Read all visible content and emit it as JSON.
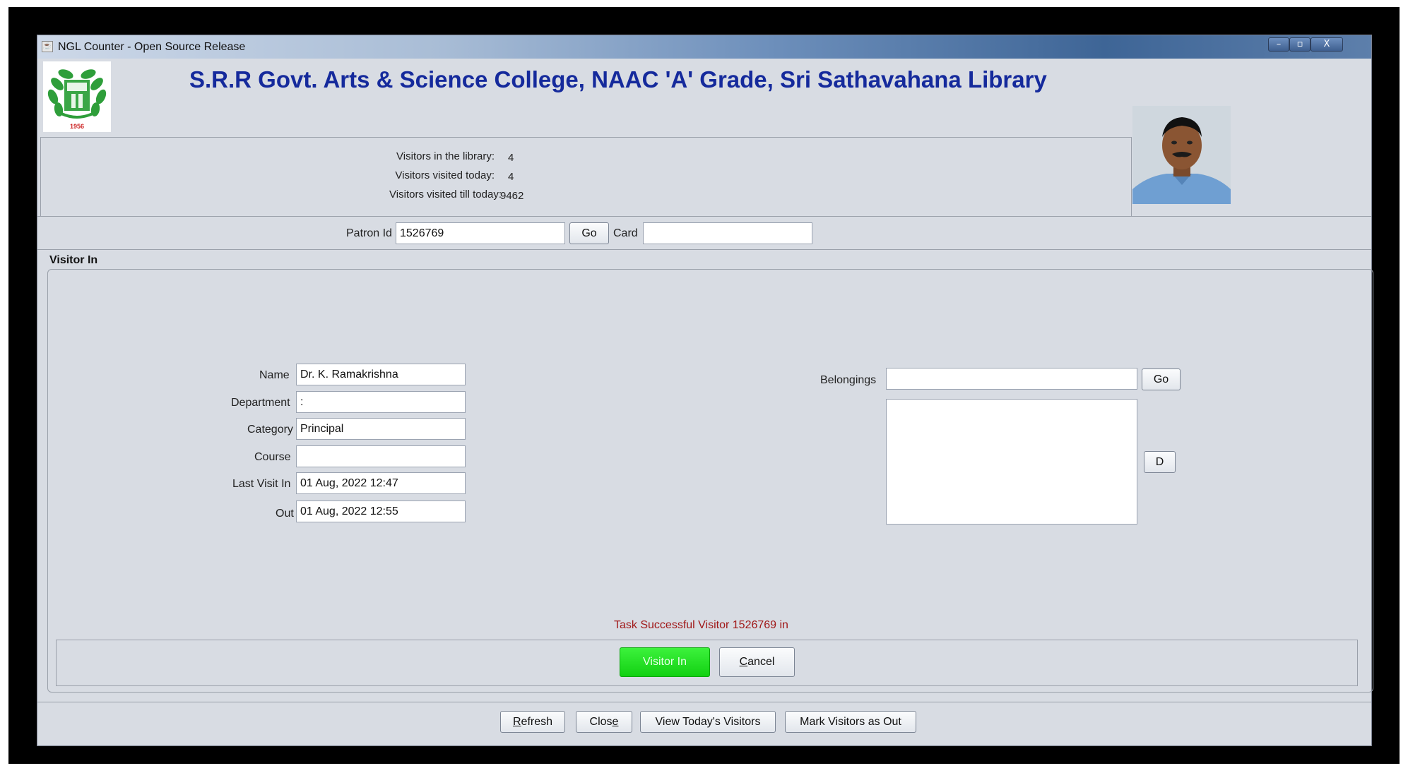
{
  "window": {
    "title": "NGL Counter - Open Source Release",
    "controls": {
      "minimize": "–",
      "maximize": "▫",
      "close": "X"
    }
  },
  "header": {
    "institution": "S.R.R Govt. Arts & Science College, NAAC 'A' Grade, Sri Sathavahana Library",
    "logo_year": "1956"
  },
  "stats": {
    "in_library_label": "Visitors in the library:",
    "in_library_value": "4",
    "today_label": "Visitors visited today:",
    "today_value": "4",
    "till_today_label": "Visitors visited till today:",
    "till_today_value": "9462"
  },
  "patron": {
    "id_label": "Patron Id",
    "id_value": "1526769",
    "go_label": "Go",
    "card_label": "Card",
    "card_value": ""
  },
  "visitor_in": {
    "section_title": "Visitor In",
    "name_label": "Name",
    "name_value": "Dr. K. Ramakrishna",
    "department_label": "Department",
    "department_value": ":",
    "category_label": "Category",
    "category_value": "Principal",
    "course_label": "Course",
    "course_value": "",
    "last_visit_in_label": "Last Visit In",
    "last_visit_in_value": "01 Aug, 2022 12:47",
    "out_label": "Out",
    "out_value": "01 Aug, 2022 12:55",
    "belongings_label": "Belongings",
    "belongings_value": "",
    "belongings_go_label": "Go",
    "belongings_delete_label": "D",
    "status_message": "Task Successful  Visitor 1526769 in",
    "visitor_in_button": "Visitor In",
    "cancel_button_first": "C",
    "cancel_button_rest": "ancel"
  },
  "footer": {
    "refresh_first": "R",
    "refresh_rest": "efresh",
    "close_start": "Clos",
    "close_underlined": "e",
    "view_today": "View Today's Visitors",
    "mark_out": "Mark Visitors as Out"
  },
  "colors": {
    "heading": "#152a9c",
    "status_text": "#a01818",
    "visitor_in_button": "#22dd22",
    "window_bg": "#d8dce3"
  }
}
